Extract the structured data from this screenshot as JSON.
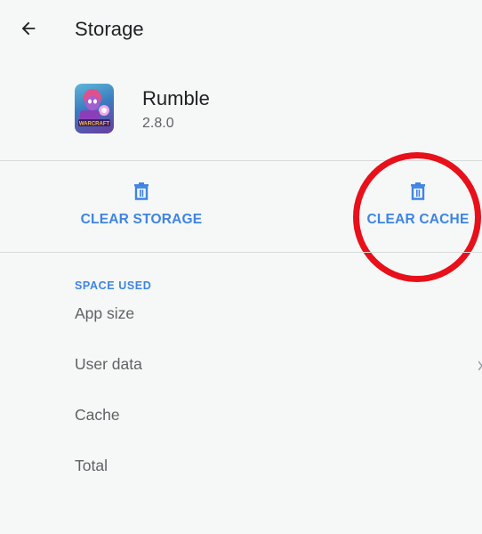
{
  "header": {
    "back_icon": "arrow-back-icon",
    "title": "Storage"
  },
  "app": {
    "name": "Rumble",
    "version": "2.8.0",
    "icon_text": "WARCRAFT",
    "icon_name": "app-icon-warcraft-rumble"
  },
  "actions": {
    "clear_storage": {
      "label": "CLEAR STORAGE",
      "icon": "trash-icon"
    },
    "clear_cache": {
      "label": "CLEAR CACHE",
      "icon": "trash-icon"
    }
  },
  "space_used": {
    "section_title": "SPACE USED",
    "rows": [
      {
        "label": "App size"
      },
      {
        "label": "User data"
      },
      {
        "label": "Cache"
      },
      {
        "label": "Total"
      }
    ]
  },
  "colors": {
    "accent": "#3f84e5",
    "annotation": "#e8101a",
    "background": "#f5f8f6"
  }
}
